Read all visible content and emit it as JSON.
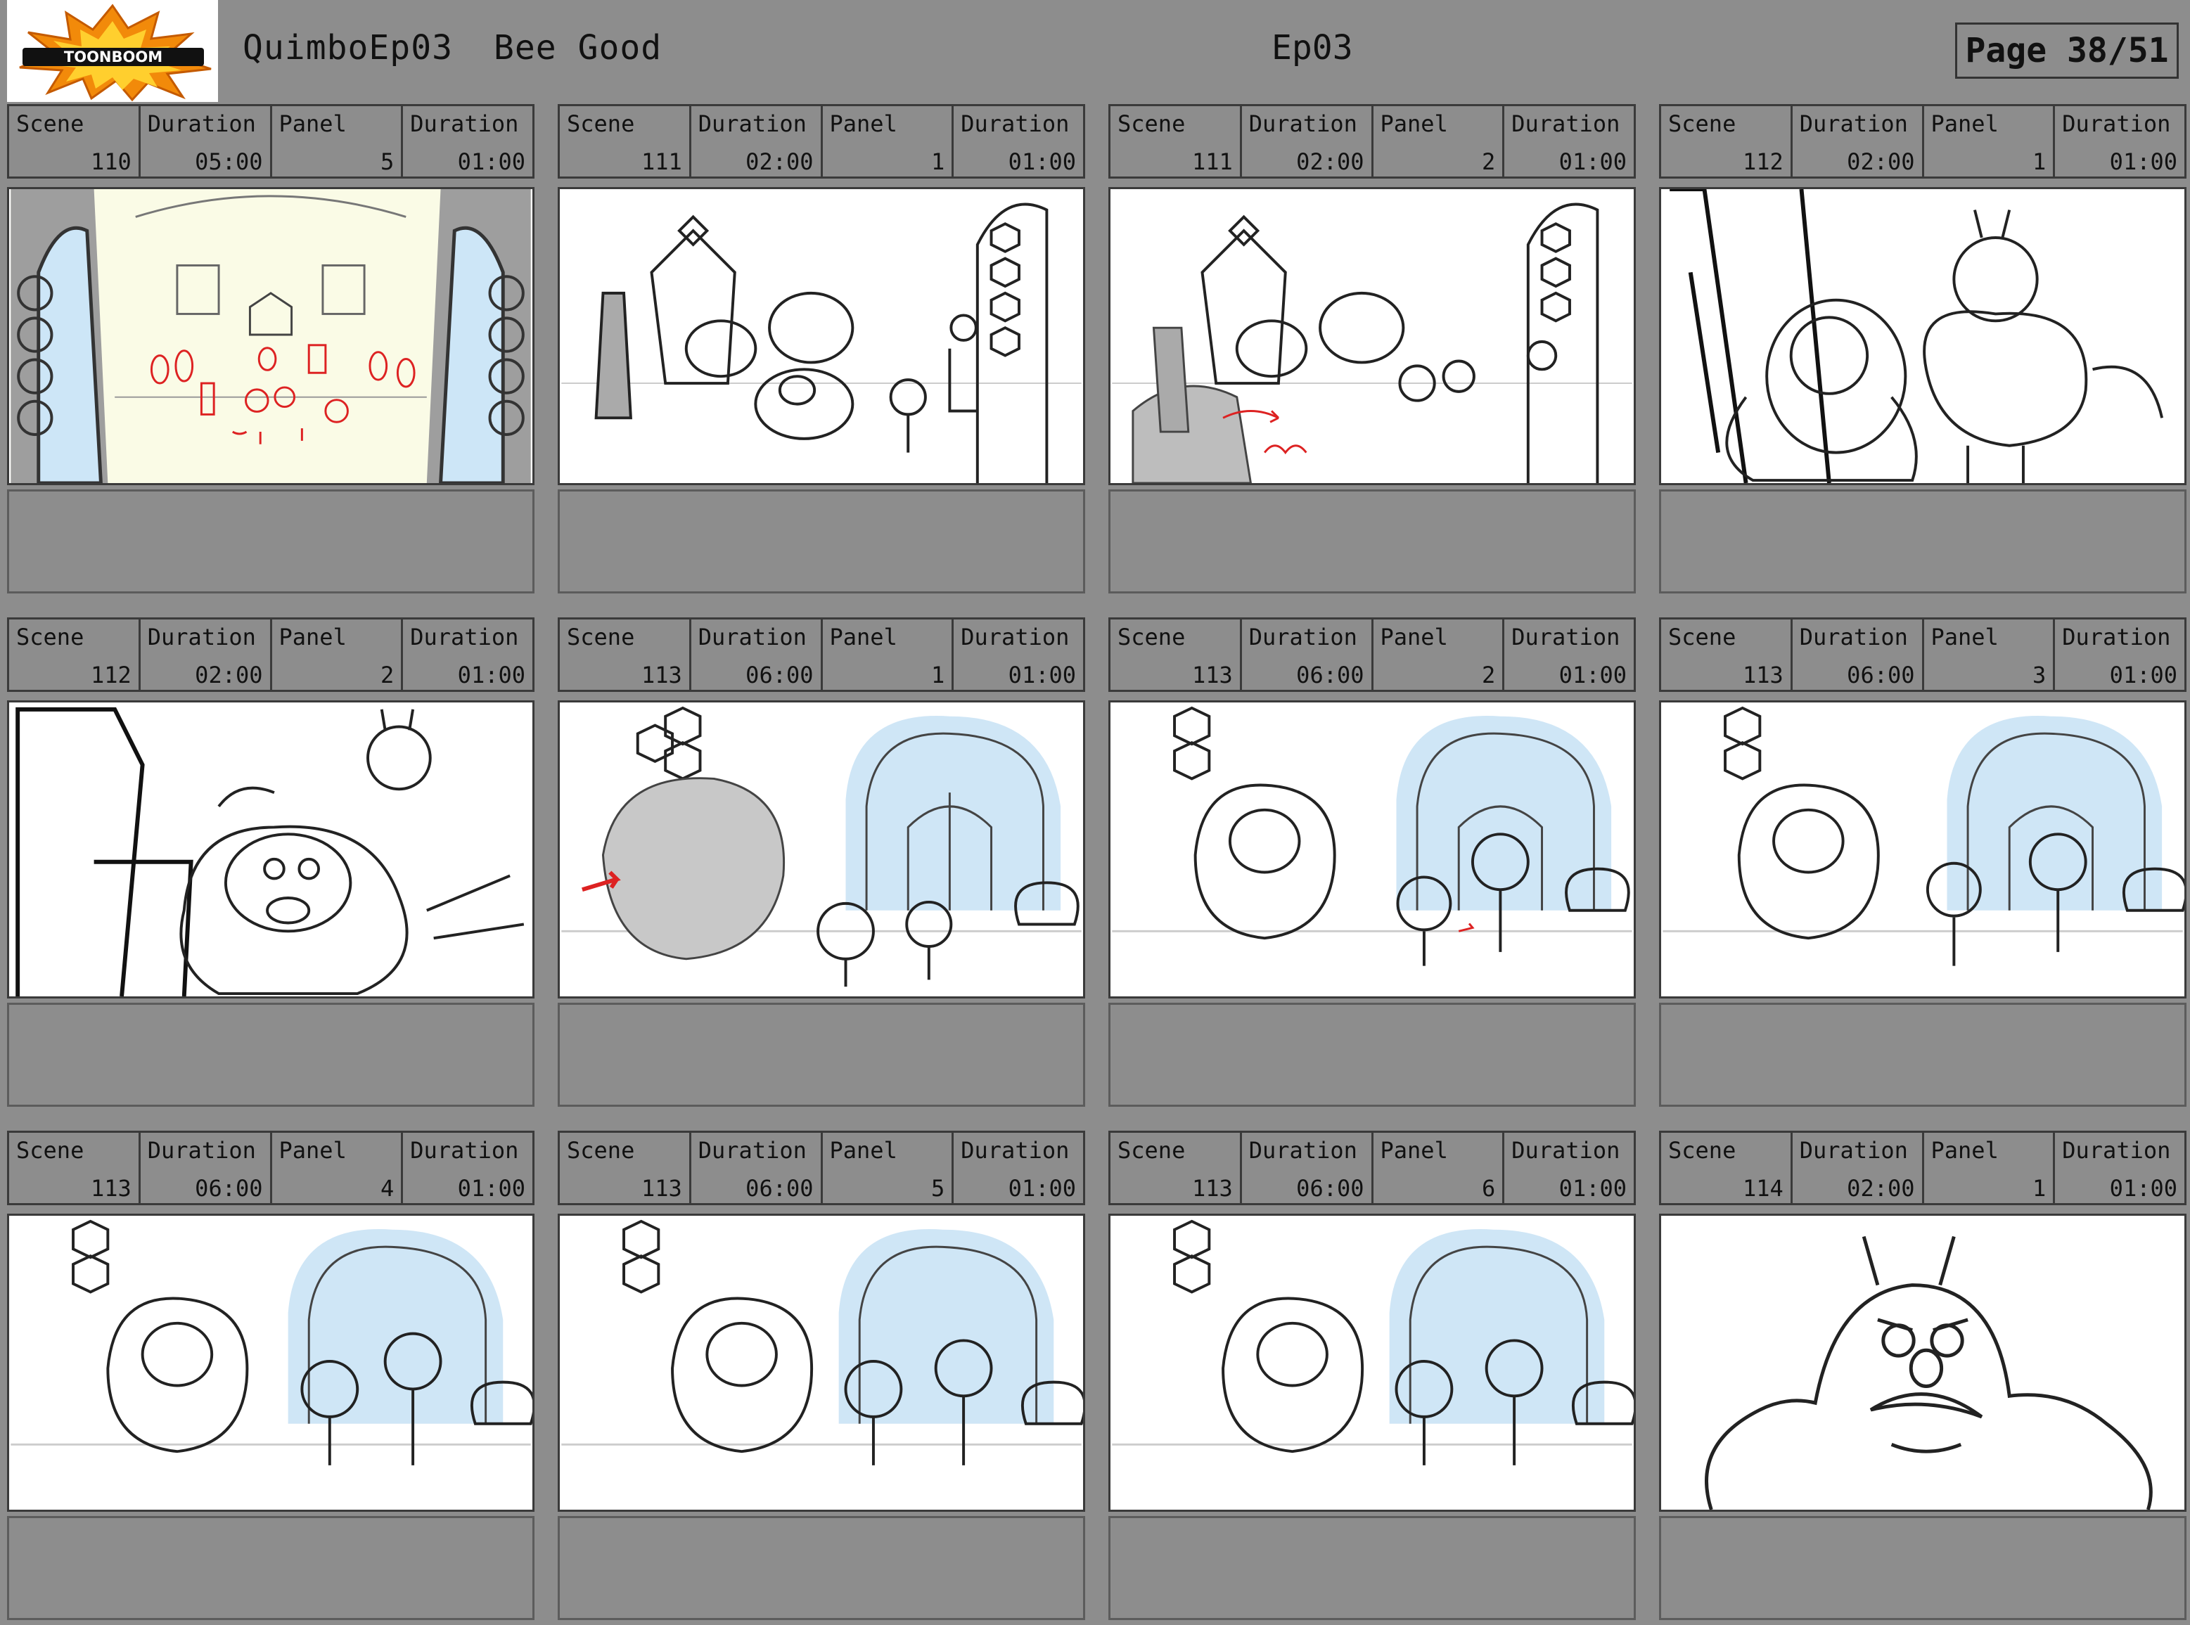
{
  "header": {
    "logo_text": "TOONBOOM",
    "project": "QuimboEp03",
    "episode_title": "Bee Good",
    "episode_code": "Ep03",
    "page": "Page 38/51"
  },
  "labels": {
    "scene": "Scene",
    "duration": "Duration",
    "panel": "Panel",
    "panel_duration": "Duration"
  },
  "panels": [
    {
      "scene": "110",
      "scene_duration": "05:00",
      "panel": "5",
      "panel_duration": "01:00"
    },
    {
      "scene": "111",
      "scene_duration": "02:00",
      "panel": "1",
      "panel_duration": "01:00"
    },
    {
      "scene": "111",
      "scene_duration": "02:00",
      "panel": "2",
      "panel_duration": "01:00"
    },
    {
      "scene": "112",
      "scene_duration": "02:00",
      "panel": "1",
      "panel_duration": "01:00"
    },
    {
      "scene": "112",
      "scene_duration": "02:00",
      "panel": "2",
      "panel_duration": "01:00"
    },
    {
      "scene": "113",
      "scene_duration": "06:00",
      "panel": "1",
      "panel_duration": "01:00"
    },
    {
      "scene": "113",
      "scene_duration": "06:00",
      "panel": "2",
      "panel_duration": "01:00"
    },
    {
      "scene": "113",
      "scene_duration": "06:00",
      "panel": "3",
      "panel_duration": "01:00"
    },
    {
      "scene": "113",
      "scene_duration": "06:00",
      "panel": "4",
      "panel_duration": "01:00"
    },
    {
      "scene": "113",
      "scene_duration": "06:00",
      "panel": "5",
      "panel_duration": "01:00"
    },
    {
      "scene": "113",
      "scene_duration": "06:00",
      "panel": "6",
      "panel_duration": "01:00"
    },
    {
      "scene": "114",
      "scene_duration": "02:00",
      "panel": "1",
      "panel_duration": "01:00"
    }
  ]
}
